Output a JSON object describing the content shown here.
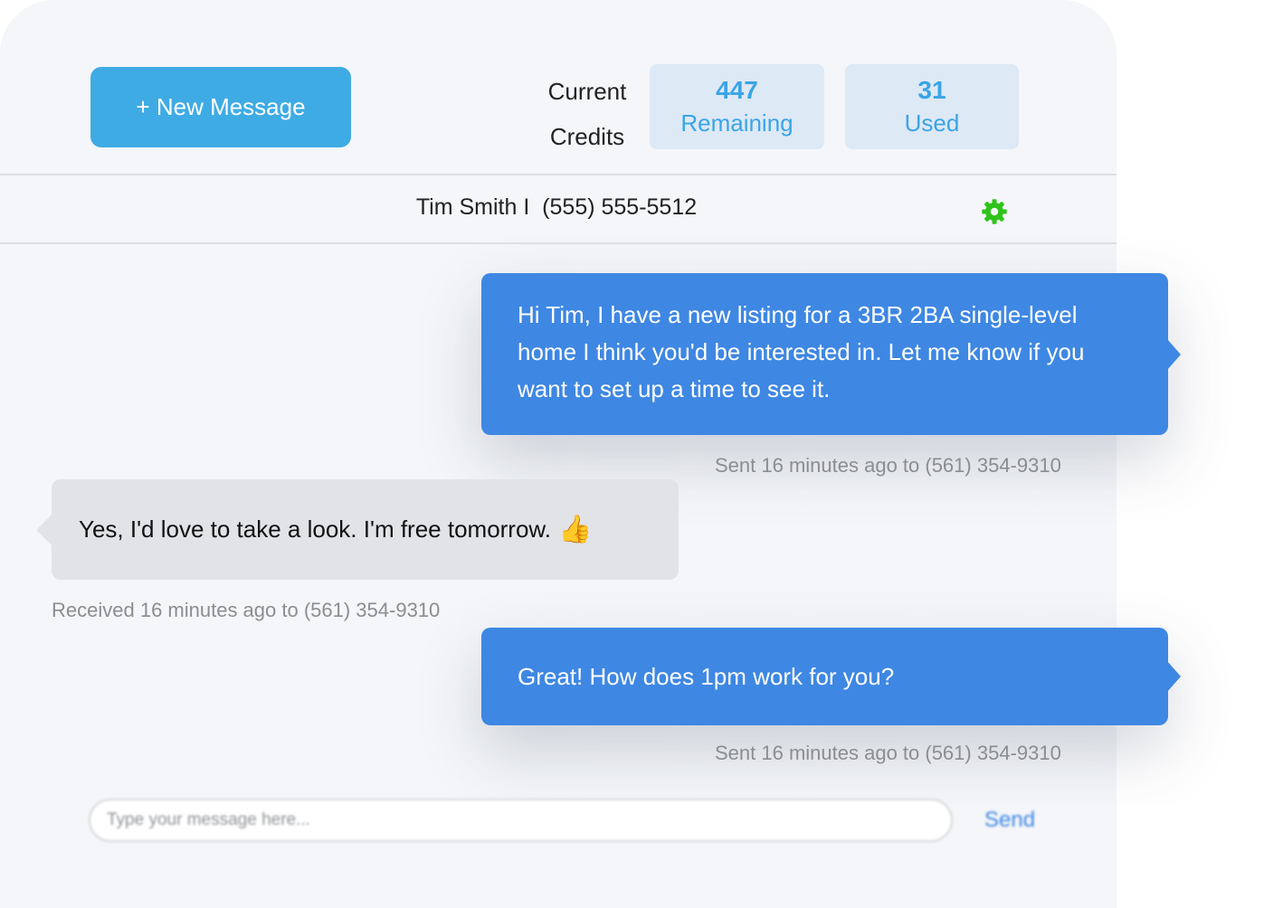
{
  "header": {
    "new_message_label": "+ New Message",
    "credits_label_line1": "Current",
    "credits_label_line2": "Credits",
    "remaining": {
      "value": "447",
      "label": "Remaining"
    },
    "used": {
      "value": "31",
      "label": "Used"
    }
  },
  "contact": {
    "name_line": "Tim Smith I  (555) 555-5512",
    "settings_icon": "gear-icon"
  },
  "messages": [
    {
      "direction": "outgoing",
      "text": "Hi Tim, I have a new listing for a 3BR 2BA single-level home I think you'd be interested in. Let me know if you want to set up a time to see it.",
      "meta": "Sent 16 minutes ago to (561) 354-9310"
    },
    {
      "direction": "incoming",
      "text": "Yes, I'd love to take a look. I'm free tomorrow.",
      "emoji": "👍",
      "meta": "Received 16 minutes ago to (561) 354-9310"
    },
    {
      "direction": "outgoing",
      "text": "Great! How does 1pm work for you?",
      "meta": "Sent 16 minutes ago to (561) 354-9310"
    }
  ],
  "composer": {
    "placeholder": "Type your message here...",
    "send_label": "Send"
  },
  "colors": {
    "primary_button": "#3fabe4",
    "outgoing_bubble": "#3e87e3",
    "incoming_bubble": "#e2e3e7",
    "stat_box": "#dde9f5",
    "gear_icon": "#2ec31a"
  }
}
